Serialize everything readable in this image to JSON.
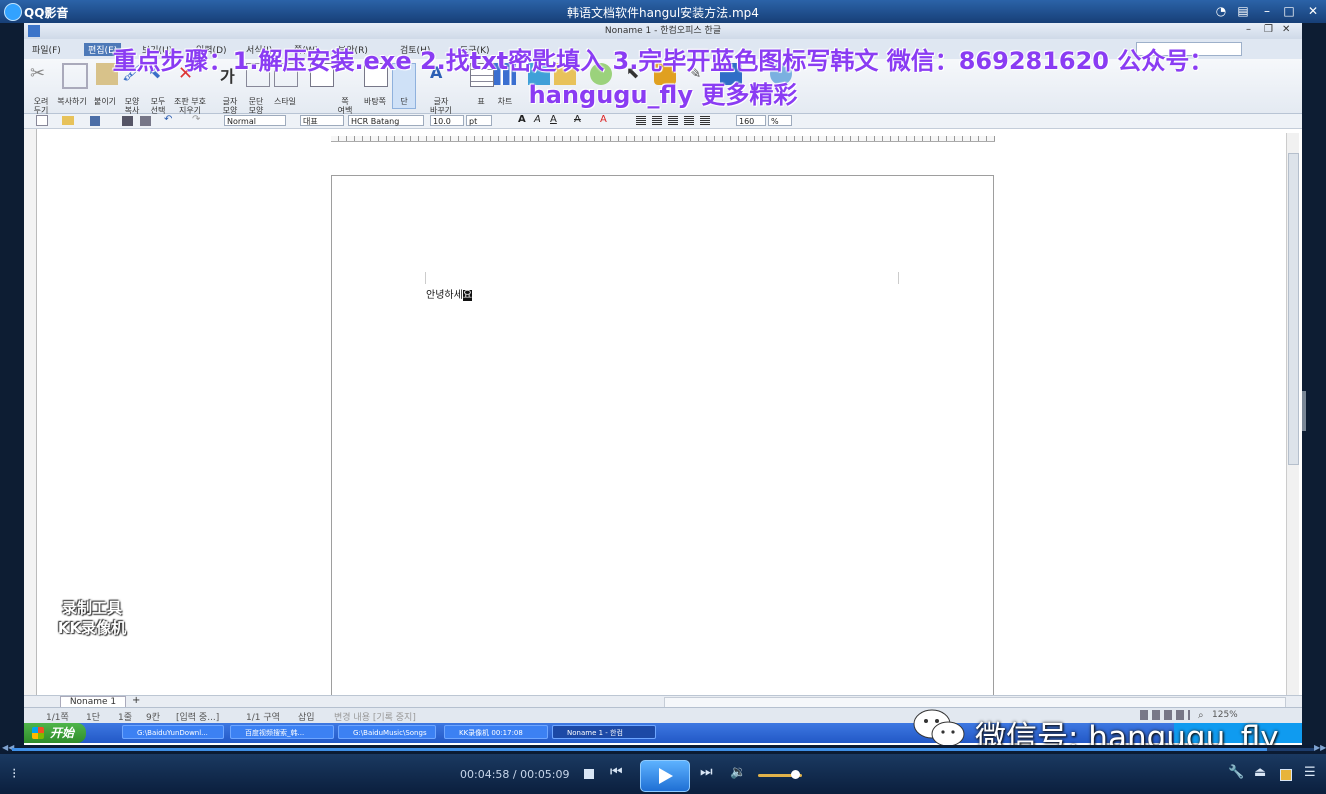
{
  "player": {
    "app_name": "QQ影音",
    "file_title": "韩语文档软件hangul安装方法.mp4",
    "current_time": "00:04:58",
    "total_time": "00:05:09",
    "time_separator": " / ",
    "progress": 0.964,
    "volume": 0.86
  },
  "hangul": {
    "window_title": "Noname 1 - 한컴오피스 한글",
    "menu": [
      "파일(F)",
      "편집(E)",
      "보기(U)",
      "입력(D)",
      "서식(J)",
      "쪽(W)",
      "보안(R)",
      "검토(H)",
      "도구(K)"
    ],
    "ribbon_labels": [
      "오려\n두기",
      "복사하기",
      "붙이기",
      "모양\n복사",
      "모두\n선택",
      "조판 부호\n지우기",
      "글자\n모양",
      "문단\n모양",
      "스타일",
      "쪽\n여백",
      "바탕쪽",
      "단",
      "글자\n바꾸기",
      "표",
      "차트"
    ],
    "style_select": "Normal",
    "language_select": "대표",
    "font_select": "HCR Batang",
    "font_size": "10.0",
    "size_unit": "pt",
    "line_spacing": "160",
    "line_spacing_unit": "%",
    "document_text": "안녕하세",
    "cursor_char": "요",
    "sheet_tab": "Noname 1",
    "status_items": [
      "1/1쪽",
      "1단",
      "1줄",
      "9칸",
      "[입력 중...]",
      "1/1 구역",
      "삽입",
      "변경 내용 [기록 중지]"
    ],
    "zoom": "125%"
  },
  "taskbar": {
    "start_label": "开始",
    "tasks": [
      "G:\\BaiduYunDownl...",
      "百度视频搜索_韩...",
      "G:\\BaiduMusic\\Songs",
      "KK录像机 00:17:08",
      "Noname 1 - 한컴"
    ]
  },
  "overlay": {
    "caption_line1": "重点步骤：1.解压安装.exe 2.找txt密匙填入 3.完毕开蓝色图标写韩文 微信：869281620 公众号：",
    "caption_line2": "hangugu_fly 更多精彩",
    "rec_line1": "录制工具",
    "rec_line2": "KK录像机",
    "wechat_text": "微信号: hangugu_fly"
  },
  "colors": {
    "caption": "#8a3cf3",
    "player_bar": "#173f77",
    "taskbar": "#2258c6",
    "play_button": "#2f86e8"
  }
}
